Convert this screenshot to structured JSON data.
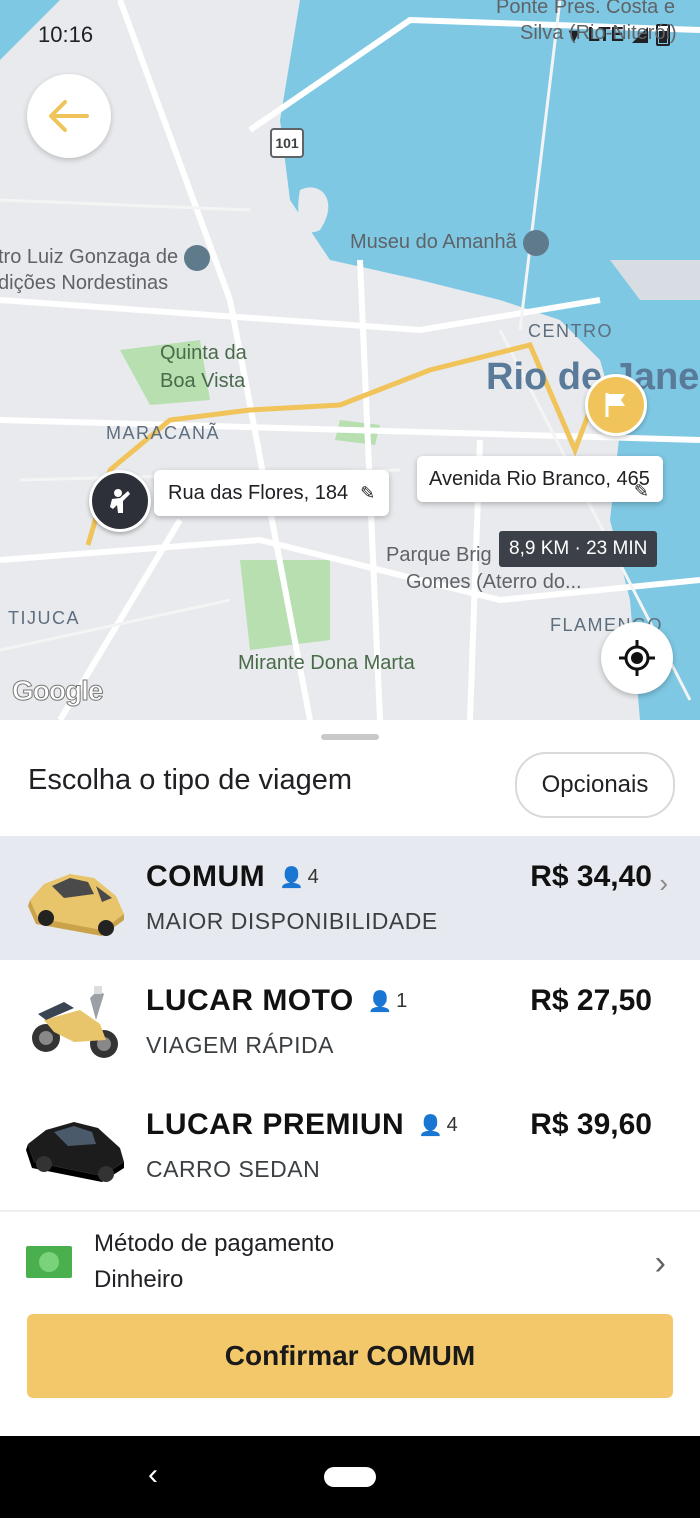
{
  "status_bar": {
    "time": "10:16",
    "network": "LTE"
  },
  "map": {
    "route_shield": "101",
    "labels": {
      "ponte": "Ponte Pres. Costa e",
      "ponte2": "Silva (Rio-Niterói)",
      "museu": "Museu do Amanhã",
      "centro_luiz_1": "tro Luiz Gonzaga de",
      "centro_luiz_2": "dições Nordestinas",
      "quinta_1": "Quinta da",
      "quinta_2": "Boa Vista",
      "centro": "CENTRO",
      "rio": "Rio de Jane",
      "maracana": "MARACANÃ",
      "parque_1": "Parque Brig",
      "parque_2": "Gomes (Aterro do...",
      "tijuca": "TIJUCA",
      "flamengo": "FLAMENGO",
      "mirante": "Mirante Dona Marta"
    },
    "origin_address": "Rua das Flores, 184",
    "destination_address": "Avenida Rio Branco, 465",
    "eta": "8,9 KM · 23 MIN",
    "attribution": "Google"
  },
  "sheet": {
    "title": "Escolha o tipo de viagem",
    "options_button": "Opcionais",
    "rides": [
      {
        "name": "COMUM",
        "seats": "4",
        "subtitle": "MAIOR DISPONIBILIDADE",
        "price": "R$ 34,40",
        "selected": true,
        "car_color": "#e8c46a"
      },
      {
        "name": "LUCAR MOTO",
        "seats": "1",
        "subtitle": "VIAGEM RÁPIDA",
        "price": "R$ 27,50",
        "selected": false
      },
      {
        "name": "LUCAR PREMIUN",
        "seats": "4",
        "subtitle": "CARRO SEDAN",
        "price": "R$ 39,60",
        "selected": false,
        "car_color": "#1c1c1c"
      }
    ],
    "payment": {
      "label": "Método de pagamento",
      "value": "Dinheiro"
    },
    "confirm_button": "Confirmar COMUM"
  },
  "colors": {
    "accent": "#f2c86a",
    "water": "#7ec8e3",
    "park": "#b8dfb0",
    "selected_row": "#e6e9ef"
  }
}
